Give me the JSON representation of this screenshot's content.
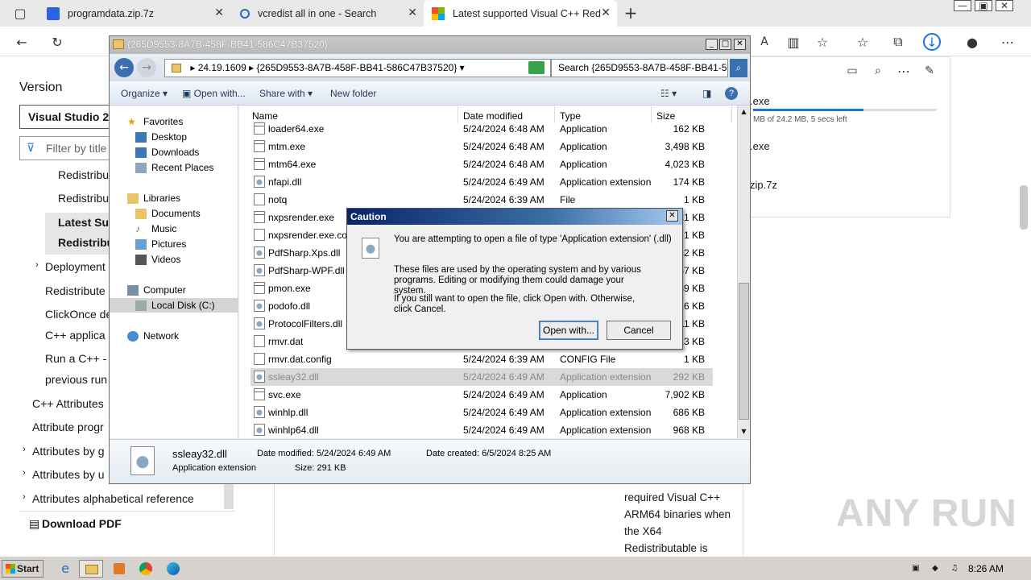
{
  "browser": {
    "tabs": [
      {
        "label": "programdata.zip.7z"
      },
      {
        "label": "vcredist all in one - Search"
      },
      {
        "label": "Latest supported Visual C++ Red"
      }
    ]
  },
  "doc": {
    "version_label": "Version",
    "version_value": "Visual Studio 20",
    "filter_placeholder": "Filter by title",
    "nav": [
      "Redistribu",
      "Redistribu",
      "Latest Sup",
      "Redistribu",
      "Deployment",
      "Redistribute",
      "ClickOnce de",
      "C++ applica",
      "Run a C++ -",
      "previous run",
      "C++ Attributes",
      "Attribute progr",
      "Attributes by g",
      "Attributes by u",
      "Attributes alphabetical reference"
    ],
    "download_pdf": "Download PDF",
    "body_lines": [
      "required Visual C++",
      "ARM64 binaries when",
      "the X64",
      "Redistributable is"
    ]
  },
  "downloads": {
    "item1": ".exe",
    "item1_status": "MB of 24.2 MB, 5 secs left",
    "item1_progress": 0.6,
    "item2": ".exe",
    "item3": "zip.7z"
  },
  "explorer": {
    "title": "{265D9553-8A7B-458F-BB41-586C47B37520}",
    "address": [
      "24.19.1609",
      "{265D9553-8A7B-458F-BB41-586C47B37520}"
    ],
    "search": "Search {265D9553-8A7B-458F-BB41-5...",
    "commands": [
      "Organize",
      "Open with...",
      "Share with",
      "New folder"
    ],
    "nav": {
      "favorites": "Favorites",
      "desktop": "Desktop",
      "downloads": "Downloads",
      "recent": "Recent Places",
      "libraries": "Libraries",
      "documents": "Documents",
      "music": "Music",
      "pictures": "Pictures",
      "videos": "Videos",
      "computer": "Computer",
      "localdisk": "Local Disk (C:)",
      "network": "Network"
    },
    "columns": [
      "Name",
      "Date modified",
      "Type",
      "Size"
    ],
    "files": [
      {
        "name": "loader64.exe",
        "date": "5/24/2024 6:48 AM",
        "type": "Application",
        "size": "162 KB",
        "icon": "app"
      },
      {
        "name": "mtm.exe",
        "date": "5/24/2024 6:48 AM",
        "type": "Application",
        "size": "3,498 KB",
        "icon": "app"
      },
      {
        "name": "mtm64.exe",
        "date": "5/24/2024 6:48 AM",
        "type": "Application",
        "size": "4,023 KB",
        "icon": "app"
      },
      {
        "name": "nfapi.dll",
        "date": "5/24/2024 6:49 AM",
        "type": "Application extension",
        "size": "174 KB",
        "icon": "dll"
      },
      {
        "name": "notq",
        "date": "5/24/2024 6:39 AM",
        "type": "File",
        "size": "1 KB",
        "icon": "file"
      },
      {
        "name": "nxpsrender.exe",
        "date": "",
        "type": "",
        "size": "21 KB",
        "icon": "app"
      },
      {
        "name": "nxpsrender.exe.con",
        "date": "",
        "type": "",
        "size": "1 KB",
        "icon": "file"
      },
      {
        "name": "PdfSharp.Xps.dll",
        "date": "",
        "type": "",
        "size": "142 KB",
        "icon": "dll"
      },
      {
        "name": "PdfSharp-WPF.dll",
        "date": "",
        "type": "",
        "size": "557 KB",
        "icon": "dll"
      },
      {
        "name": "pmon.exe",
        "date": "",
        "type": "",
        "size": "289 KB",
        "icon": "app"
      },
      {
        "name": "podofo.dll",
        "date": "",
        "type": "",
        "size": "816 KB",
        "icon": "dll"
      },
      {
        "name": "ProtocolFilters.dll",
        "date": "",
        "type": "",
        "size": "411 KB",
        "icon": "dll"
      },
      {
        "name": "rmvr.dat",
        "date": "",
        "type": "",
        "size": "613 KB",
        "icon": "file"
      },
      {
        "name": "rmvr.dat.config",
        "date": "5/24/2024 6:39 AM",
        "type": "CONFIG File",
        "size": "1 KB",
        "icon": "file"
      },
      {
        "name": "ssleay32.dll",
        "date": "5/24/2024 6:49 AM",
        "type": "Application extension",
        "size": "292 KB",
        "icon": "dll",
        "selected": true
      },
      {
        "name": "svc.exe",
        "date": "5/24/2024 6:49 AM",
        "type": "Application",
        "size": "7,902 KB",
        "icon": "app"
      },
      {
        "name": "winhlp.dll",
        "date": "5/24/2024 6:49 AM",
        "type": "Application extension",
        "size": "686 KB",
        "icon": "dll"
      },
      {
        "name": "winhlp64.dll",
        "date": "5/24/2024 6:49 AM",
        "type": "Application extension",
        "size": "968 KB",
        "icon": "dll"
      }
    ],
    "details": {
      "name": "ssleay32.dll",
      "type": "Application extension",
      "modified": "Date modified: 5/24/2024 6:49 AM",
      "size": "Size: 291 KB",
      "created": "Date created: 6/5/2024 8:25 AM"
    }
  },
  "caution": {
    "title": "Caution",
    "line1": "You are attempting to open a file of type 'Application extension' (.dll)",
    "line2": "These files are used by the operating system and by various programs. Editing or modifying them could damage your system.",
    "line3": "If you still want to open the file, click Open with. Otherwise, click Cancel.",
    "open_label": "Open with...",
    "cancel_label": "Cancel"
  },
  "taskbar": {
    "start": "Start",
    "clock": "8:26 AM"
  },
  "watermark": "ANY RUN"
}
